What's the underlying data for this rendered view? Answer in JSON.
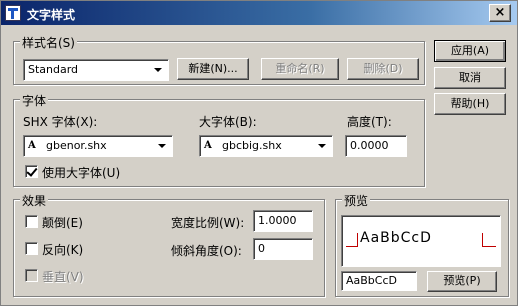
{
  "window": {
    "title": "文字样式",
    "close_glyph": "×"
  },
  "style_name_group": {
    "legend": "样式名(S)",
    "selected_style": "Standard",
    "new_button": "新建(N)...",
    "rename_button": "重命名(R)",
    "delete_button": "删除(D)"
  },
  "side_buttons": {
    "apply": "应用(A)",
    "cancel": "取消",
    "help": "帮助(H)"
  },
  "font_group": {
    "legend": "字体",
    "shx_label": "SHX 字体(X):",
    "shx_value": "gbenor.shx",
    "big_label": "大字体(B):",
    "big_value": "gbcbig.shx",
    "height_label": "高度(T):",
    "height_value": "0.0000",
    "use_big_font_label": "使用大字体(U)",
    "use_big_font_checked": true,
    "font_glyph": "A"
  },
  "effects_group": {
    "legend": "效果",
    "upside_down_label": "颠倒(E)",
    "backwards_label": "反向(K)",
    "vertical_label": "垂直(V)",
    "width_factor_label": "宽度比例(W):",
    "width_factor_value": "1.0000",
    "oblique_label": "倾斜角度(O):",
    "oblique_value": "0"
  },
  "preview_group": {
    "legend": "预览",
    "sample_text": "AaBbCcD",
    "preview_input_value": "AaBbCcD",
    "preview_button": "预览(P)"
  },
  "colors": {
    "title_start": "#0a246a",
    "face": "#d4d0c8",
    "guide_line": "#c00000"
  }
}
